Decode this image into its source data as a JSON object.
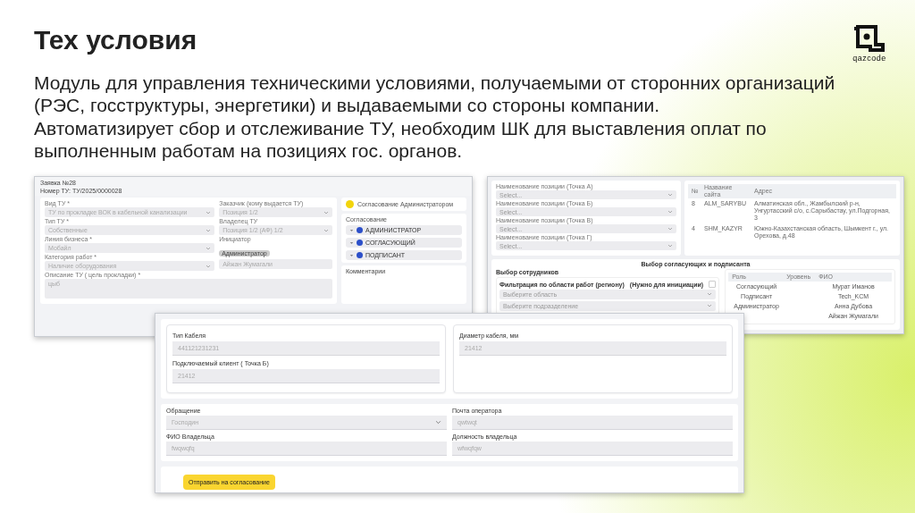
{
  "slide": {
    "title": "Тех условия",
    "description": "Модуль для управления техническими условиями, получаемыми от сторонних организаций\n(РЭС, госструктуры, энергетики) и выдаваемыми со стороны компании.\nАвтоматизирует сбор и отслеживание ТУ, необходим ШК для выставления оплат по\nвыполненным работам на позициях гос. органов.",
    "logo": "qazcode"
  },
  "left_screen": {
    "title": "Заявка №28",
    "number": "Номер ТУ: ТУ/2025/0000028",
    "fields_left": [
      {
        "label": "Вид ТУ *",
        "value": "ТУ по прокладке ВОК в кабельной канализации",
        "kind": "select"
      },
      {
        "label": "Тип ТУ *",
        "value": "Собственные",
        "kind": "select"
      },
      {
        "label": "Линия бизнеса *",
        "value": "Мобайл",
        "kind": "select"
      },
      {
        "label": "Категория работ *",
        "value": "Наличие оборудования",
        "kind": "select"
      }
    ],
    "fields_right": [
      {
        "label": "Заказчик (кому выдается ТУ)",
        "value": "Позиция 1/2",
        "kind": "select"
      },
      {
        "label": "Владелец ТУ",
        "value": "Позиция 1/2 (АФ) 1/2",
        "kind": "select"
      },
      {
        "label": "Инициатор",
        "badge": "Администратор",
        "value": "Айжан Жумагали",
        "kind": "badge"
      }
    ],
    "description_field": {
      "label": "Описание ТУ ( цель прокладки) *",
      "value": "цыб"
    },
    "status": {
      "label": "Согласование Администратором",
      "color": "#f2d40c"
    },
    "approval": {
      "title": "Согласование",
      "steps": [
        "АДМИНИСТРАТОР",
        "СОГЛАСУЮЩИЙ",
        "ПОДПИСАНТ"
      ]
    },
    "comments_title": "Комментарии"
  },
  "right_screen": {
    "point_fields": [
      {
        "label": "Наименование позиции (Точка А)",
        "placeholder": "Select..."
      },
      {
        "label": "Наименование позиции (Точка Б)",
        "placeholder": "Select..."
      },
      {
        "label": "Наименование позиции (Точка В)",
        "placeholder": "Select..."
      },
      {
        "label": "Наименование позиции (Точка Г)",
        "placeholder": "Select..."
      }
    ],
    "sites_table": {
      "columns": [
        "№",
        "Название сайта",
        "Адрес"
      ],
      "rows": [
        [
          "8",
          "ALM_SARYBU",
          "Алматинская обл., Жамбылский р-н, Унгуртасский с/о, с.Сарыбастау, ул.Подгорная, 3"
        ],
        [
          "4",
          "SHM_KAZYR",
          "Южно-Казахстанская область, Шымкент г., ул. Орехова, д.48"
        ]
      ]
    },
    "section_title": "Выбор согласующих и подписанта",
    "employees": {
      "title": "Выбор сотрудников",
      "filter_label": "Фильтрация по области работ (региону)",
      "checkbox": {
        "label": "(Нужно для инициации)",
        "checked": false
      },
      "selects": [
        {
          "placeholder": "Выберите область"
        },
        {
          "placeholder": "Выберите подразделение"
        }
      ]
    },
    "roles_table": {
      "columns": [
        "Роль",
        "Уровень",
        "ФИО"
      ],
      "rows": [
        {
          "role": "Согласующий",
          "fio": "Мурат Иманов"
        },
        {
          "role": "Подписант",
          "fio": "Tech_KCM"
        },
        {
          "role": "Администратор",
          "fio": "Анна Дубова"
        },
        {
          "fio": "Айжан Жумагали"
        }
      ]
    }
  },
  "front_screen": {
    "cable_fields": [
      {
        "label": "Тип Кабеля",
        "value": "441121231231"
      },
      {
        "label": "Подключаемый клиент ( Точка Б)",
        "value": "21412"
      }
    ],
    "diameter_fields": [
      {
        "label": "Диаметр кабеля, мм",
        "value": "21412"
      }
    ],
    "owner_fields": [
      {
        "label": "Обращение",
        "value": "Господин",
        "kind": "select"
      },
      {
        "label": "Почта оператора",
        "value": "qwtwqt",
        "kind": "text"
      },
      {
        "label": "ФИО Владельца",
        "value": "fwqwqfq",
        "kind": "text"
      },
      {
        "label": "Должность владельца",
        "value": "wfwqfqw",
        "kind": "text"
      }
    ],
    "submit_button": "Отправить на согласование"
  }
}
